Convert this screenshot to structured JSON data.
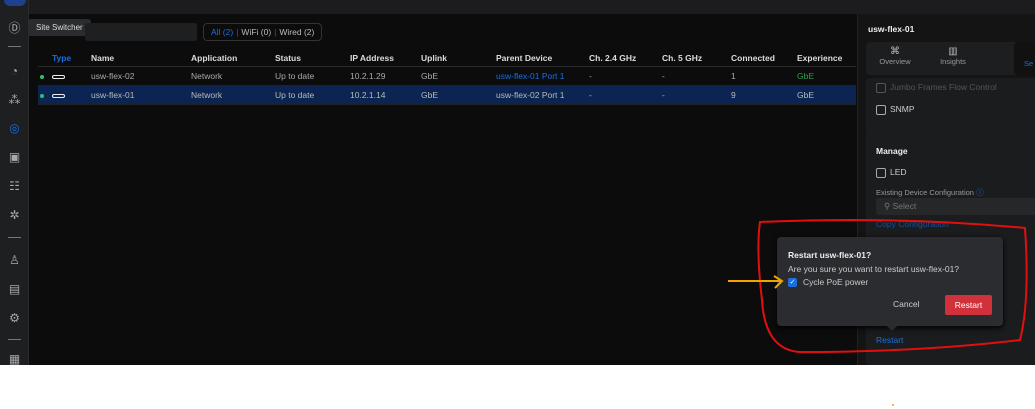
{
  "tooltip": "Site Switcher",
  "filters": [
    {
      "label": "All (2)"
    },
    {
      "label": "WiFi (0)"
    },
    {
      "label": "Wired (2)"
    }
  ],
  "table": {
    "headers": [
      "Type",
      "Name",
      "Application",
      "Status",
      "IP Address",
      "Uplink",
      "Parent Device",
      "Ch. 2.4 GHz",
      "Ch. 5 GHz",
      "Connected",
      "Experience"
    ],
    "rows": [
      {
        "name": "usw-flex-02",
        "application": "Network",
        "status": "Up to date",
        "ip": "10.2.1.29",
        "uplink": "GbE",
        "parent": "usw-flex-01 Port 1",
        "ch24": "-",
        "ch5": "-",
        "connected": "1",
        "experience": "GbE"
      },
      {
        "name": "usw-flex-01",
        "application": "Network",
        "status": "Up to date",
        "ip": "10.2.1.14",
        "uplink": "GbE",
        "parent": "usw-flex-02 Port 1",
        "ch24": "-",
        "ch5": "-",
        "connected": "9",
        "experience": "GbE"
      }
    ]
  },
  "panel": {
    "title": "usw-flex-01",
    "tabs": [
      "Overview",
      "Insights",
      "Se"
    ],
    "partial": "Jumbo Frames   Flow Control",
    "snmp": "SNMP",
    "manage": "Manage",
    "led": "LED",
    "existing_config": "Existing Device Configuration",
    "select_placeholder": "Select",
    "copy_config": "Copy Configuration",
    "restart_link": "Restart"
  },
  "dialog": {
    "title": "Restart usw-flex-01?",
    "message": "Are you sure you want to restart usw-flex-01?",
    "checkbox_label": "Cycle PoE power",
    "checkbox_checked": true,
    "cancel": "Cancel",
    "confirm": "Restart"
  },
  "colors": {
    "accent": "#1a6fe0",
    "danger": "#d1313b",
    "annotation_red": "#e01010",
    "annotation_arrow": "#f0a500"
  }
}
